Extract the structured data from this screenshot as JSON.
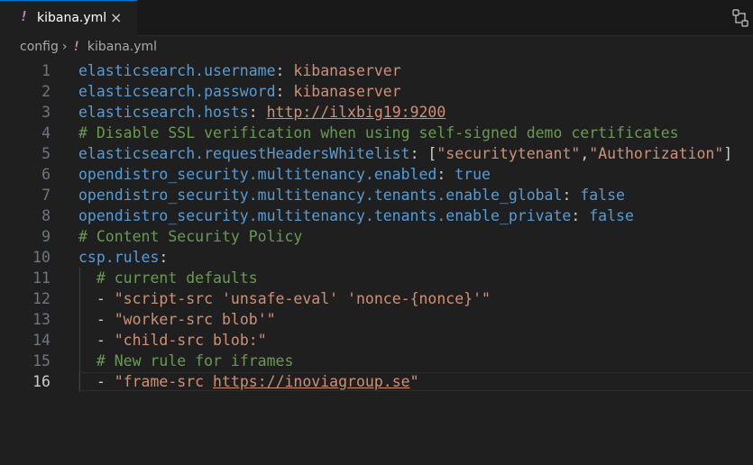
{
  "tab": {
    "title": "kibana.yml",
    "icon": "yaml-file-icon",
    "close": "×"
  },
  "breadcrumb": {
    "folder": "config",
    "file": "kibana.yml"
  },
  "editor": {
    "active_line": 16,
    "lines": [
      {
        "n": "1",
        "tokens": [
          [
            "k",
            "elasticsearch.username"
          ],
          [
            "p",
            ": "
          ],
          [
            "s",
            "kibanaserver"
          ]
        ]
      },
      {
        "n": "2",
        "tokens": [
          [
            "k",
            "elasticsearch.password"
          ],
          [
            "p",
            ": "
          ],
          [
            "s",
            "kibanaserver"
          ]
        ]
      },
      {
        "n": "3",
        "tokens": [
          [
            "k",
            "elasticsearch.hosts"
          ],
          [
            "p",
            ": "
          ],
          [
            "u",
            "http://ilxbig19:9200"
          ]
        ]
      },
      {
        "n": "4",
        "tokens": [
          [
            "c",
            "# Disable SSL verification when using self-signed demo certificates"
          ]
        ]
      },
      {
        "n": "5",
        "tokens": [
          [
            "k",
            "elasticsearch.requestHeadersWhitelist"
          ],
          [
            "p",
            ": ["
          ],
          [
            "s",
            "\"securitytenant\""
          ],
          [
            "p",
            ","
          ],
          [
            "s",
            "\"Authorization\""
          ],
          [
            "p",
            "]"
          ]
        ]
      },
      {
        "n": "6",
        "tokens": [
          [
            "k",
            "opendistro_security.multitenancy.enabled"
          ],
          [
            "p",
            ": "
          ],
          [
            "b",
            "true"
          ]
        ]
      },
      {
        "n": "7",
        "tokens": [
          [
            "k",
            "opendistro_security.multitenancy.tenants.enable_global"
          ],
          [
            "p",
            ": "
          ],
          [
            "b",
            "false"
          ]
        ]
      },
      {
        "n": "8",
        "tokens": [
          [
            "k",
            "opendistro_security.multitenancy.tenants.enable_private"
          ],
          [
            "p",
            ": "
          ],
          [
            "b",
            "false"
          ]
        ]
      },
      {
        "n": "9",
        "tokens": [
          [
            "c",
            "# Content Security Policy"
          ]
        ]
      },
      {
        "n": "10",
        "tokens": [
          [
            "k",
            "csp.rules"
          ],
          [
            "p",
            ":"
          ]
        ]
      },
      {
        "n": "11",
        "tokens": [
          [
            "p",
            "  "
          ],
          [
            "c",
            "# current defaults"
          ]
        ]
      },
      {
        "n": "12",
        "tokens": [
          [
            "p",
            "  - "
          ],
          [
            "s",
            "\"script-src 'unsafe-eval' 'nonce-{nonce}'\""
          ]
        ]
      },
      {
        "n": "13",
        "tokens": [
          [
            "p",
            "  - "
          ],
          [
            "s",
            "\"worker-src blob'\""
          ]
        ]
      },
      {
        "n": "14",
        "tokens": [
          [
            "p",
            "  - "
          ],
          [
            "s",
            "\"child-src blob:\""
          ]
        ]
      },
      {
        "n": "15",
        "tokens": [
          [
            "p",
            "  "
          ],
          [
            "c",
            "# New rule for iframes"
          ]
        ]
      },
      {
        "n": "16",
        "tokens": [
          [
            "p",
            "  - "
          ],
          [
            "s",
            "\"frame-src "
          ],
          [
            "u",
            "https://inoviagroup.se"
          ],
          [
            "s",
            "\""
          ]
        ]
      }
    ]
  },
  "colors": {
    "keyword": "#569cd6",
    "string": "#ce9178",
    "comment": "#6a9955",
    "accent": "#0078d4",
    "yaml_icon": "#c586c0"
  }
}
